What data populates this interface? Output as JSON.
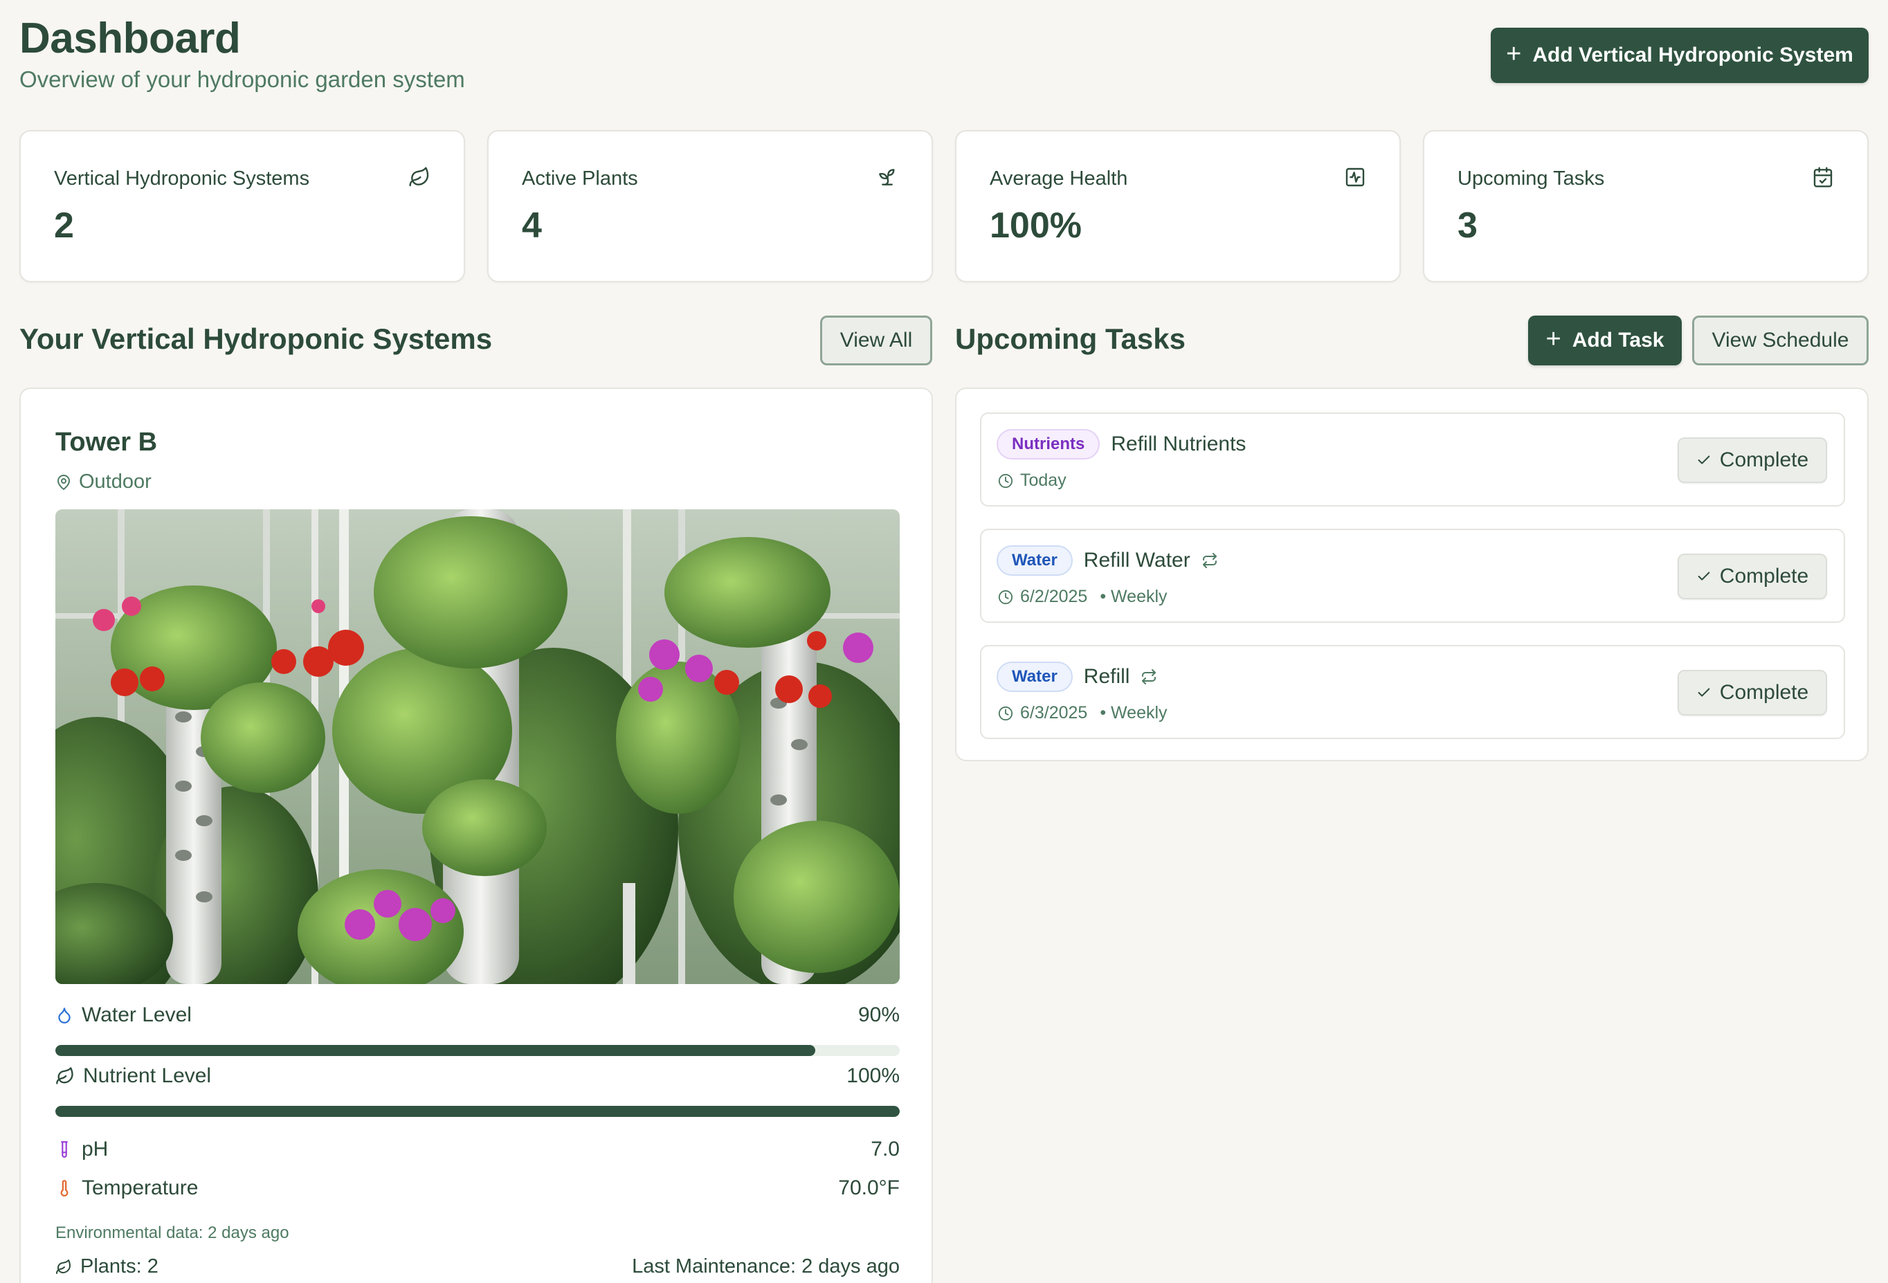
{
  "header": {
    "title": "Dashboard",
    "subtitle": "Overview of your hydroponic garden system",
    "add_system_label": "Add Vertical Hydroponic System"
  },
  "stats": [
    {
      "label": "Vertical Hydroponic Systems",
      "value": "2",
      "icon": "leaf-icon"
    },
    {
      "label": "Active Plants",
      "value": "4",
      "icon": "sprout-icon"
    },
    {
      "label": "Average Health",
      "value": "100%",
      "icon": "activity-icon"
    },
    {
      "label": "Upcoming Tasks",
      "value": "3",
      "icon": "calendar-icon"
    }
  ],
  "systems_section": {
    "title": "Your Vertical Hydroponic Systems",
    "view_all_label": "View All"
  },
  "tower": {
    "name": "Tower B",
    "location": "Outdoor",
    "water_label": "Water Level",
    "water_value": "90%",
    "water_fraction": 0.9,
    "nutrient_label": "Nutrient Level",
    "nutrient_value": "100%",
    "nutrient_fraction": 1.0,
    "ph_label": "pH",
    "ph_value": "7.0",
    "temp_label": "Temperature",
    "temp_value": "70.0°F",
    "env_note": "Environmental data: 2 days ago",
    "plants_label": "Plants: 2",
    "maintenance_label": "Last Maintenance: 2 days ago"
  },
  "tasks_section": {
    "title": "Upcoming Tasks",
    "add_task_label": "Add Task",
    "view_schedule_label": "View Schedule"
  },
  "tasks": [
    {
      "badge": "Nutrients",
      "title": "Refill Nutrients",
      "date": "Today",
      "recurrence": "",
      "complete_label": "Complete"
    },
    {
      "badge": "Water",
      "title": "Refill Water",
      "date": "6/2/2025",
      "recurrence": "• Weekly",
      "complete_label": "Complete"
    },
    {
      "badge": "Water",
      "title": "Refill",
      "date": "6/3/2025",
      "recurrence": "• Weekly",
      "complete_label": "Complete"
    }
  ],
  "colors": {
    "primary": "#2f5340",
    "background": "#f7f6f2",
    "nutrients_badge": "#7b2fc0",
    "water_badge": "#1f56b8"
  }
}
